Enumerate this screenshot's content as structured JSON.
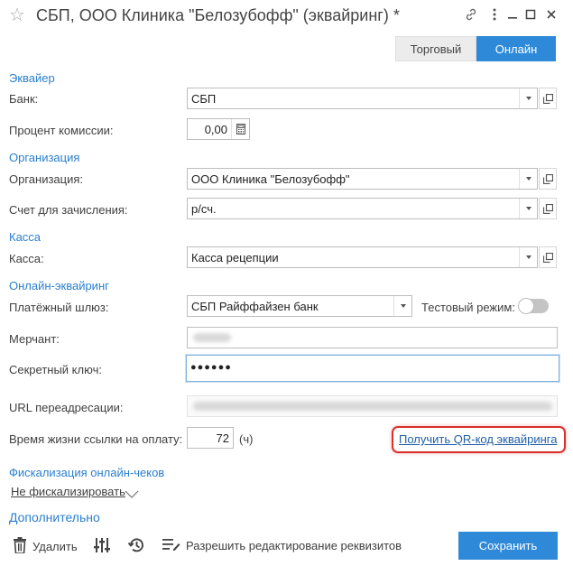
{
  "window": {
    "title": "СБП, ООО Клиника \"Белозубофф\" (эквайринг) *"
  },
  "modes": {
    "trade": "Торговый",
    "online": "Онлайн"
  },
  "sections": {
    "acquirer": "Эквайер",
    "organization": "Организация",
    "cashbox": "Касса",
    "online_acquiring": "Онлайн-эквайринг",
    "fiscalization": "Фискализация онлайн-чеков",
    "additional": "Дополнительно"
  },
  "fields": {
    "bank": {
      "label": "Банк:",
      "value": "СБП"
    },
    "commission": {
      "label": "Процент комиссии:",
      "value": "0,00"
    },
    "organization": {
      "label": "Организация:",
      "value": "ООО Клиника \"Белозубофф\""
    },
    "account": {
      "label": "Счет для зачисления:",
      "value": "р/сч."
    },
    "cashbox": {
      "label": "Касса:",
      "value": "Касса рецепции"
    },
    "gateway": {
      "label": "Платёжный шлюз:",
      "value": "СБП Райффайзен банк"
    },
    "test_mode": {
      "label": "Тестовый режим:",
      "on": false
    },
    "merchant": {
      "label": "Мерчант:"
    },
    "secret_key": {
      "label": "Секретный ключ:",
      "value": "●●●●●●"
    },
    "redirect_url": {
      "label": "URL переадресации:"
    },
    "link_lifetime": {
      "label": "Время жизни ссылки на оплату:",
      "value": "72",
      "unit": "(ч)"
    }
  },
  "qr_link": "Получить QR-код эквайринга",
  "fiscal_option": "Не фискализировать",
  "toolbar": {
    "delete": "Удалить",
    "allow_edit": "Разрешить редактирование реквизитов",
    "save": "Сохранить"
  },
  "colors": {
    "accent": "#2e8ad8",
    "section": "#2a7fcf",
    "highlight": "#d9302c",
    "link": "#1f5fa8"
  },
  "icons": {
    "favorite": "star-outline-icon",
    "link": "link-icon",
    "more": "more-vertical-icon",
    "minimize": "minimize-icon",
    "maximize": "maximize-icon",
    "close": "close-icon",
    "dropdown": "triangle-down-icon",
    "open": "open-in-new-icon",
    "calculator": "calculator-icon",
    "delete": "trash-icon",
    "settings": "sliders-icon",
    "history": "history-icon",
    "edit": "edit-lines-icon"
  }
}
